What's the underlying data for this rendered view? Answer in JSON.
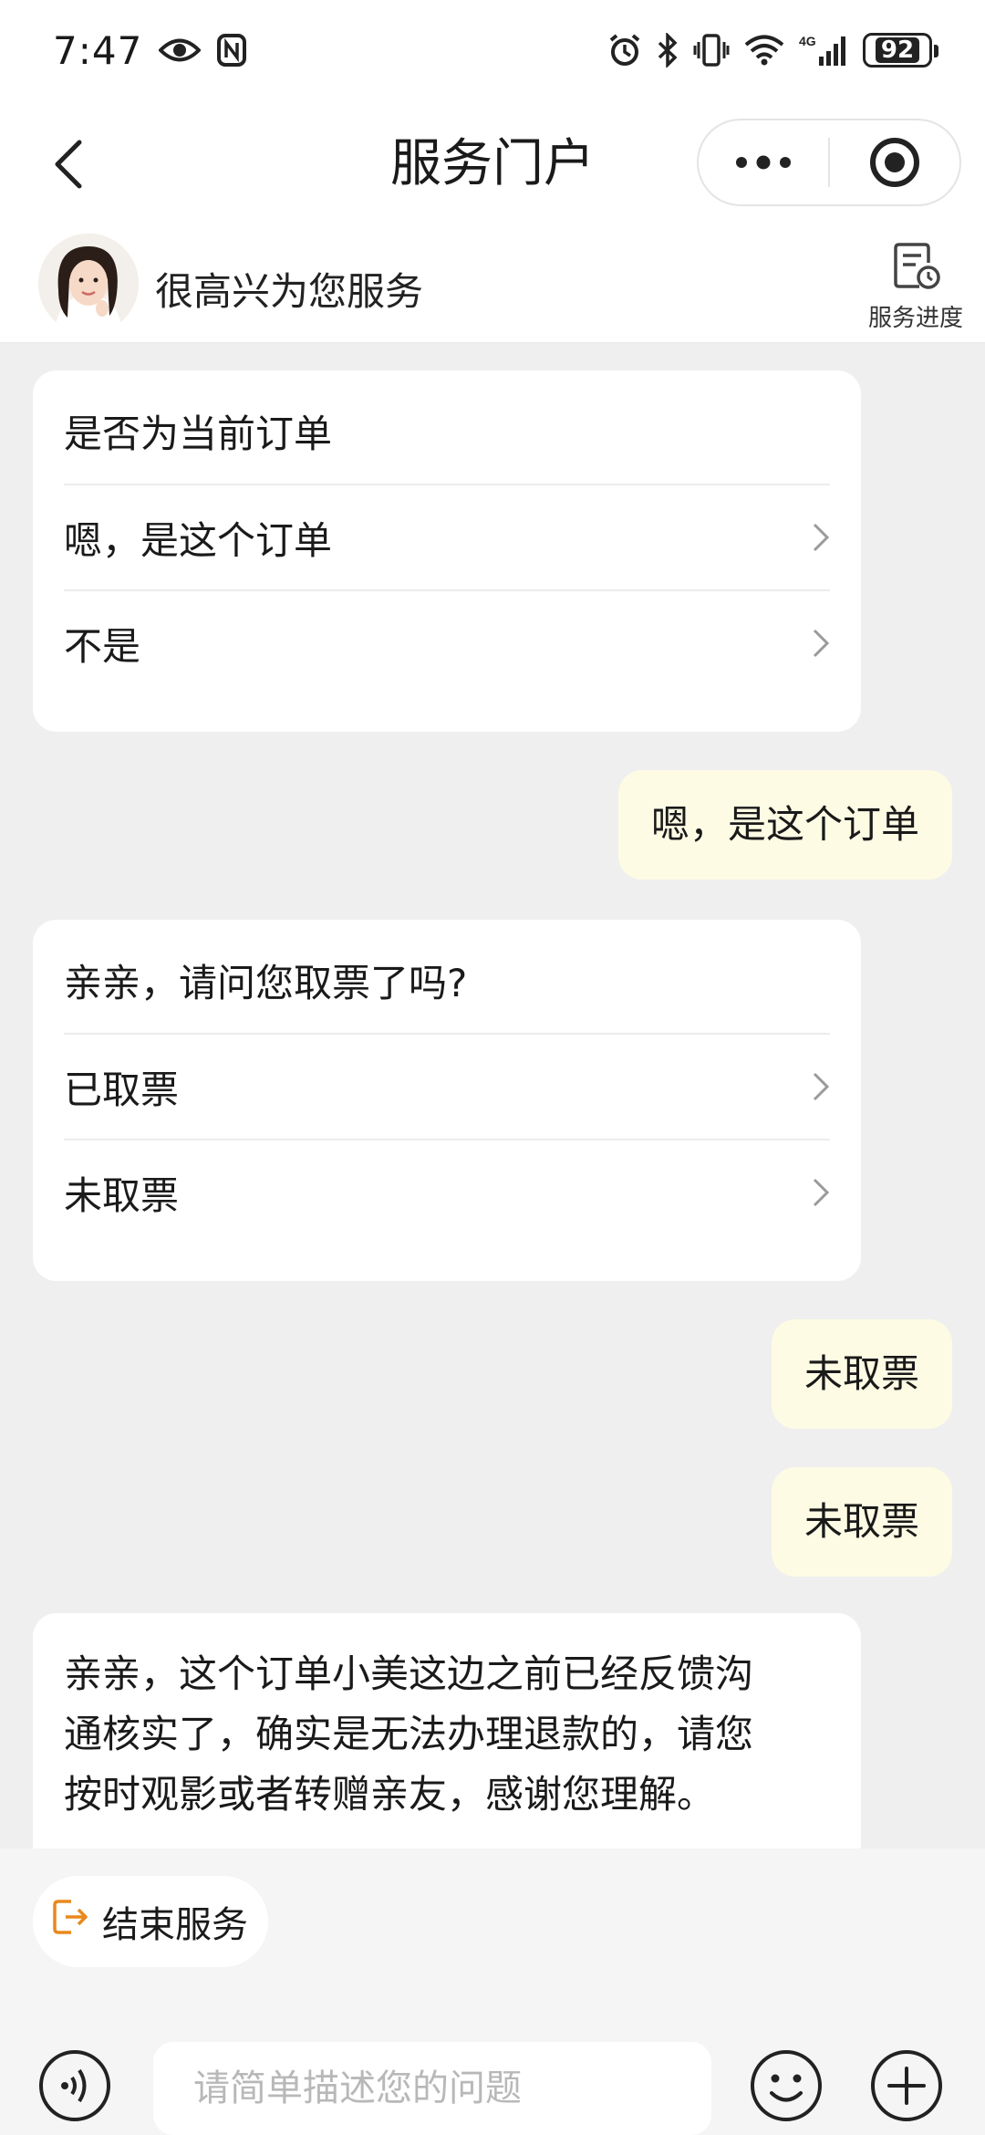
{
  "status_bar": {
    "time": "7:47",
    "network": "4G",
    "battery": "92",
    "icons": [
      "eye-icon",
      "nfc-icon",
      "alarm-icon",
      "bluetooth-icon",
      "vibrate-icon",
      "wifi-icon",
      "signal-icon",
      "battery-icon"
    ]
  },
  "nav": {
    "title": "服务门户",
    "icons": [
      "back-arrow-icon",
      "more-dots-icon",
      "target-circle-icon"
    ]
  },
  "agent": {
    "greeting": "很高兴为您服务",
    "progress_label": "服务进度"
  },
  "messages": {
    "card1": {
      "question": "是否为当前订单",
      "options": [
        "嗯，是这个订单",
        "不是"
      ]
    },
    "reply1": "嗯，是这个订单",
    "card2": {
      "question": "亲亲，请问您取票了吗?",
      "options": [
        "已取票",
        "未取票"
      ]
    },
    "reply2": "未取票",
    "reply3": "未取票",
    "card3": {
      "lines": [
        "亲亲，这个订单小美这边之前已经反馈沟",
        "通核实了，确实是无法办理退款的，请您",
        "按时观影或者转赠亲友，感谢您理解。"
      ]
    }
  },
  "footer": {
    "end_service_label": "结束服务",
    "input_placeholder": "请简单描述您的问题"
  },
  "colors": {
    "background": "#efefef",
    "user_bubble": "#fdfbe4",
    "end_icon": "#e8891c"
  }
}
